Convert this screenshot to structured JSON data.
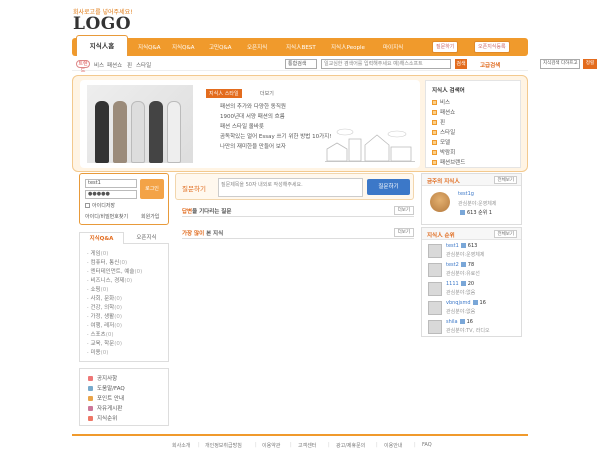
{
  "header": {
    "logo_tag": "회사로고를 넣어주세요!",
    "logo": "LOGO"
  },
  "nav": {
    "home": "지식人홈",
    "items": [
      "지식Q&A",
      "지식Q&A",
      "고민Q&A",
      "오픈지식",
      "지식人BEST",
      "지식人People",
      "마이지식"
    ],
    "btn_ask": "질문하기",
    "btn_open": "오픈지식등록"
  },
  "subnav": {
    "label": "트렌드",
    "links": [
      "비스",
      "패션쇼",
      "핀",
      "스타일"
    ],
    "select": "통합검색",
    "search_placeholder": "일교심한 겸색어를 입력해주세요 예)해스소프트",
    "search_btn": "검색",
    "advanced": "고급검색",
    "sort_select": "지식검색 다하프고",
    "sort_btn": "정렬"
  },
  "banner": {
    "tag": "지식人 스타일",
    "more": "더보기",
    "lines": [
      "패션의 추가와 다양한 동직원",
      "1900년대 서양 패션의 흐름",
      "패션 스타일 올바릇",
      "곰독학있는 얼어 Essay 쓰기 위한 방법 10가지!",
      "나만의 재미한을 만들어 보자"
    ],
    "fashion_title": "지식人 검색어",
    "fashion_items": [
      "비스",
      "패션쇼",
      "핀",
      "스타일",
      "모델",
      "박람회",
      "패션브랜드"
    ]
  },
  "login": {
    "id": "test1",
    "pw": "●●●●●",
    "btn": "로그인",
    "save_id": "아이디저장",
    "find_id": "아이디/비밀번호찾기",
    "join": "회원가입"
  },
  "category": {
    "tab_on": "지식Q&A",
    "tab_off": "오픈지식",
    "items": [
      {
        "name": "게임",
        "count": "(0)"
      },
      {
        "name": "컴퓨터, 통신",
        "count": "(0)"
      },
      {
        "name": "엔터테인먼트, 예술",
        "count": "(0)"
      },
      {
        "name": "비즈니스, 경제",
        "count": "(0)"
      },
      {
        "name": "쇼핑",
        "count": "(0)"
      },
      {
        "name": "사회, 문화",
        "count": "(0)"
      },
      {
        "name": "건강, 의학",
        "count": "(0)"
      },
      {
        "name": "가정, 생활",
        "count": "(0)"
      },
      {
        "name": "여행, 레저",
        "count": "(0)"
      },
      {
        "name": "스포츠",
        "count": "(0)"
      },
      {
        "name": "교육, 학문",
        "count": "(0)"
      },
      {
        "name": "미용",
        "count": "(0)"
      }
    ]
  },
  "links": [
    "공지사항",
    "도움말/FAQ",
    "포인트 안내",
    "자유게시판",
    "지식순위"
  ],
  "ask": {
    "label": "질문하기",
    "placeholder": "질문제목을 50자 내외로 작성해주세요.",
    "btn": "질문하기"
  },
  "sections": {
    "waiting": {
      "title_em": "답변",
      "title": "을 기다리는 질문",
      "more": "더보기"
    },
    "popular": {
      "title_em": "가장 많이",
      "title": " 본 지식",
      "more": "더보기"
    }
  },
  "featured": {
    "title": "금주의 지식人",
    "more": "전체보기",
    "name": "test1g",
    "sub1": "관심분야:운영체제",
    "stat": "613 순위 1"
  },
  "ranking": {
    "title": "지식人 순위",
    "more": "전체보기",
    "rows": [
      {
        "name": "test1",
        "count": "613",
        "field": "관심분야:운영체제"
      },
      {
        "name": "test2",
        "count": "78",
        "field": "관심분야:유료선"
      },
      {
        "name": "1111",
        "count": "20",
        "field": "관심분야:없음"
      },
      {
        "name": "vbnqjsmd",
        "count": "16",
        "field": "관심분야:없음"
      },
      {
        "name": "shila",
        "count": "16",
        "field": "관심분야:TV, 라디오"
      }
    ]
  },
  "footer": [
    "회사소개",
    "개인정보취급방침",
    "이용약관",
    "고객센터",
    "광고/제휴문의",
    "이용안내",
    "FAQ"
  ]
}
